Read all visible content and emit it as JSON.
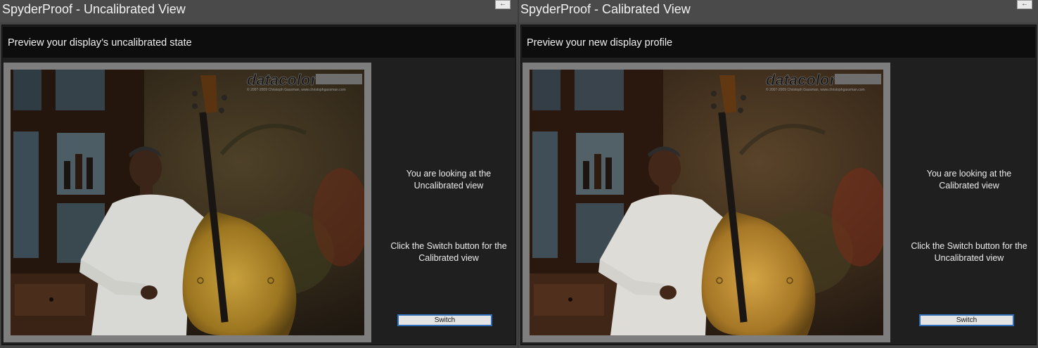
{
  "windows": [
    {
      "title": "SpyderProof - Uncalibrated View",
      "pin_label": "←",
      "header": "Preview your display’s uncalibrated state",
      "photo": {
        "logo": "datacolor",
        "credit": "© 2007-2009 Christoph Gassman, www.christophgassman.com"
      },
      "info_line1": [
        "You are looking at the",
        "Uncalibrated view"
      ],
      "info_line2": [
        "Click the Switch button for the",
        "Calibrated view"
      ],
      "switch_label": "Switch"
    },
    {
      "title": "SpyderProof - Calibrated View",
      "pin_label": "←",
      "header": "Preview your new display profile",
      "photo": {
        "logo": "datacolor",
        "credit": "© 2007-2009 Christoph Gassman, www.christophgassman.com"
      },
      "info_line1": [
        "You are looking at the",
        "Calibrated view"
      ],
      "info_line2": [
        "Click the Switch button for the",
        "Uncalibrated view"
      ],
      "switch_label": "Switch"
    }
  ],
  "colors": {
    "window_bg": "#444444",
    "content_bg": "#1f1f1f",
    "header_bg": "#0d0d0d",
    "photo_frame": "#7e7e7e",
    "button_border": "#2f6db8"
  }
}
